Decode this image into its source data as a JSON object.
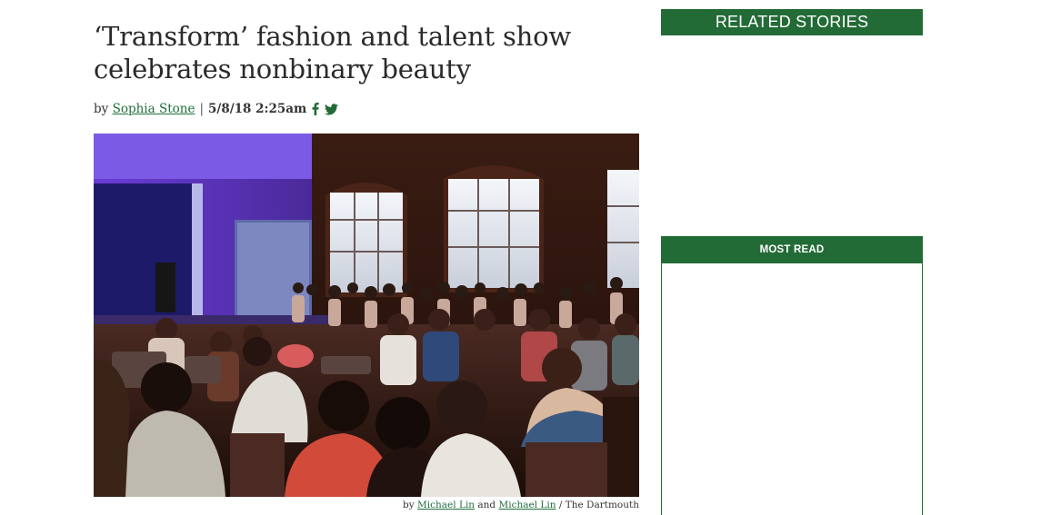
{
  "article": {
    "headline": "‘Transform’ fashion and talent show celebrates nonbinary beauty",
    "byline": {
      "prefix": "by",
      "author": "Sophia Stone",
      "separator": "|",
      "date": "5/8/18 2:25am",
      "social_icons": [
        "facebook-icon",
        "twitter-icon"
      ]
    },
    "image_caption": {
      "prefix": "by",
      "photographer_1": "Michael Lin",
      "conjunction": "and",
      "photographer_2": "Michael Lin",
      "source": "/ The Dartmouth"
    }
  },
  "sidebar": {
    "related_stories_title": "RELATED STORIES",
    "most_read_title": "MOST READ"
  },
  "colors": {
    "brand_green": "#236b36",
    "link_green": "#1f6e3c"
  }
}
